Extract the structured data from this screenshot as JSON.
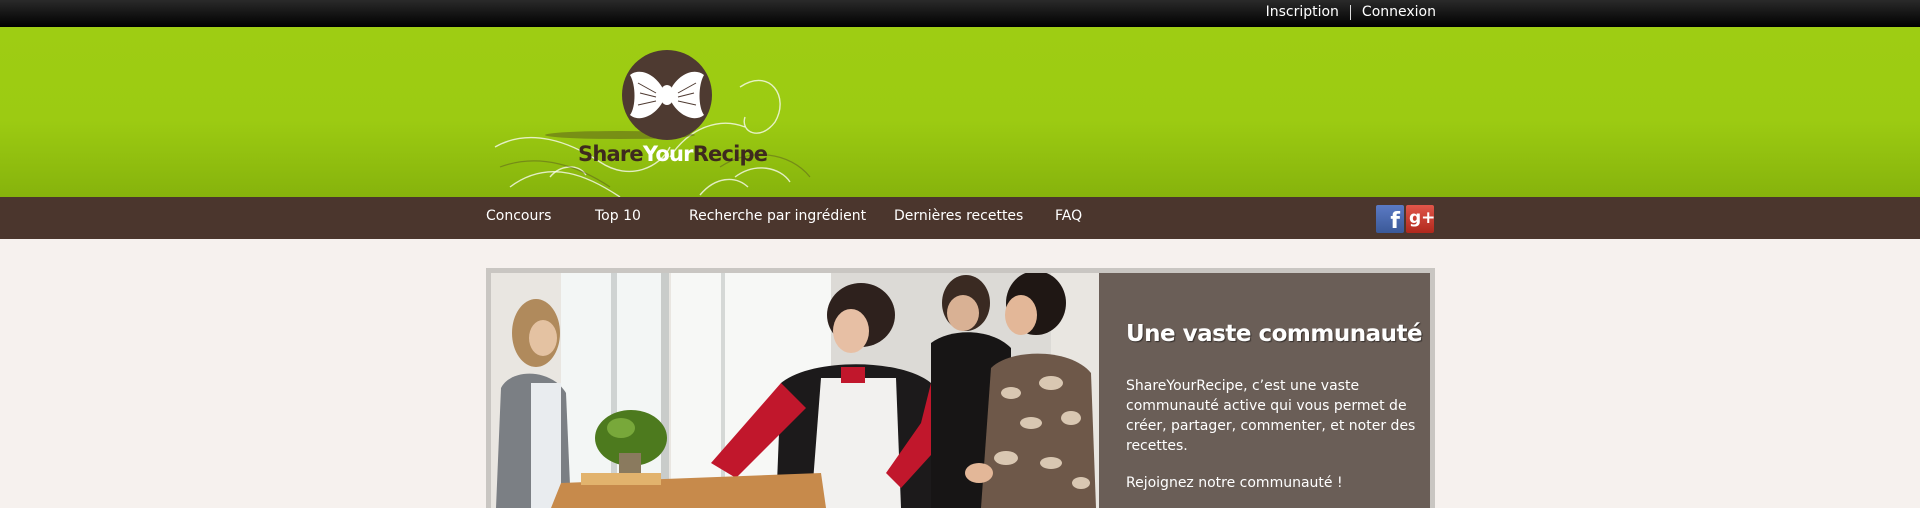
{
  "auth": {
    "register": "Inscription",
    "login": "Connexion"
  },
  "brand": {
    "name_part1": "Share",
    "name_part2": "Your",
    "name_part3": "Recipe"
  },
  "nav": {
    "items": [
      "Concours",
      "Top 10",
      "Recherche par ingrédient",
      "Dernières recettes",
      "FAQ"
    ]
  },
  "social": {
    "facebook_glyph": "f",
    "googleplus_glyph": "g+"
  },
  "slide": {
    "title": "Une vaste communauté",
    "body": "ShareYourRecipe, c’est une vaste communauté active qui vous permet de créer, partager, commenter, et noter des recettes.",
    "cta": "Rejoignez notre communauté !"
  },
  "colors": {
    "header_green": "#9ecd13",
    "nav_brown": "#4b362d",
    "page_bg": "#f6f1ee"
  }
}
